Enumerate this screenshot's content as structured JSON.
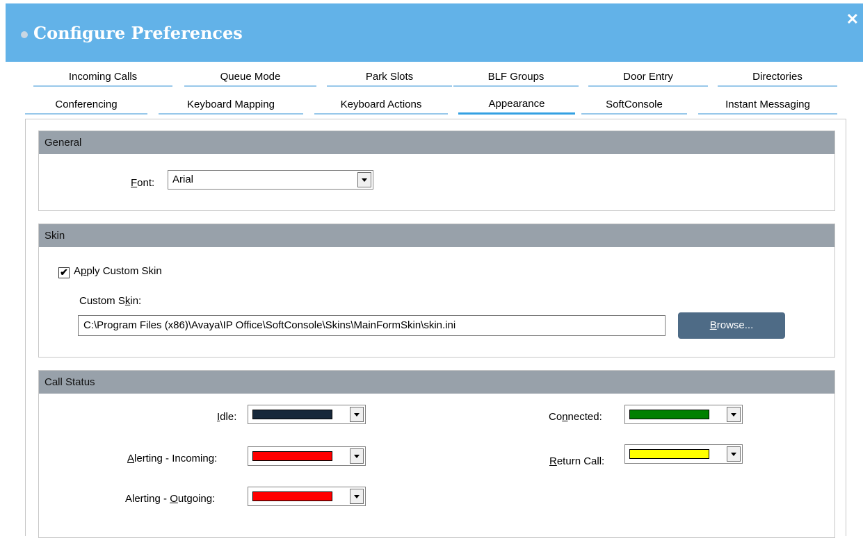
{
  "window": {
    "title": "Configure Preferences",
    "close_glyph": "✕"
  },
  "tabs_row1": [
    "Incoming Calls",
    "Queue Mode",
    "Park Slots",
    "BLF Groups",
    "Door Entry",
    "Directories"
  ],
  "tabs_row2": [
    "Conferencing",
    "Keyboard Mapping",
    "Keyboard Actions",
    "Appearance",
    "SoftConsole",
    "Instant Messaging"
  ],
  "active_tab": "Appearance",
  "general": {
    "header": "General",
    "font_label_key": "F",
    "font_label_rest": "ont:",
    "font_value": "Arial"
  },
  "skin": {
    "header": "Skin",
    "apply_pre": "A",
    "apply_key": "p",
    "apply_rest": "ply Custom Skin",
    "apply_checked": true,
    "custom_pre": "Custom S",
    "custom_key": "k",
    "custom_rest": "in:",
    "path": "C:\\Program Files (x86)\\Avaya\\IP Office\\SoftConsole\\Skins\\MainFormSkin\\skin.ini",
    "browse_key": "B",
    "browse_rest": "rowse..."
  },
  "call_status": {
    "header": "Call Status",
    "idle_key": "I",
    "idle_rest": "dle:",
    "idle_color": "#17283a",
    "alerting_in_key": "A",
    "alerting_in_rest": "lerting - Incoming:",
    "alerting_in_color": "#ff0000",
    "alerting_out_pre": "Alerting - ",
    "alerting_out_key": "O",
    "alerting_out_rest": "utgoing:",
    "alerting_out_color": "#ff0000",
    "connected_pre": "Co",
    "connected_key": "n",
    "connected_rest": "nected:",
    "connected_color": "#008000",
    "return_key": "R",
    "return_rest": "eturn Call:",
    "return_color": "#ffff00"
  }
}
